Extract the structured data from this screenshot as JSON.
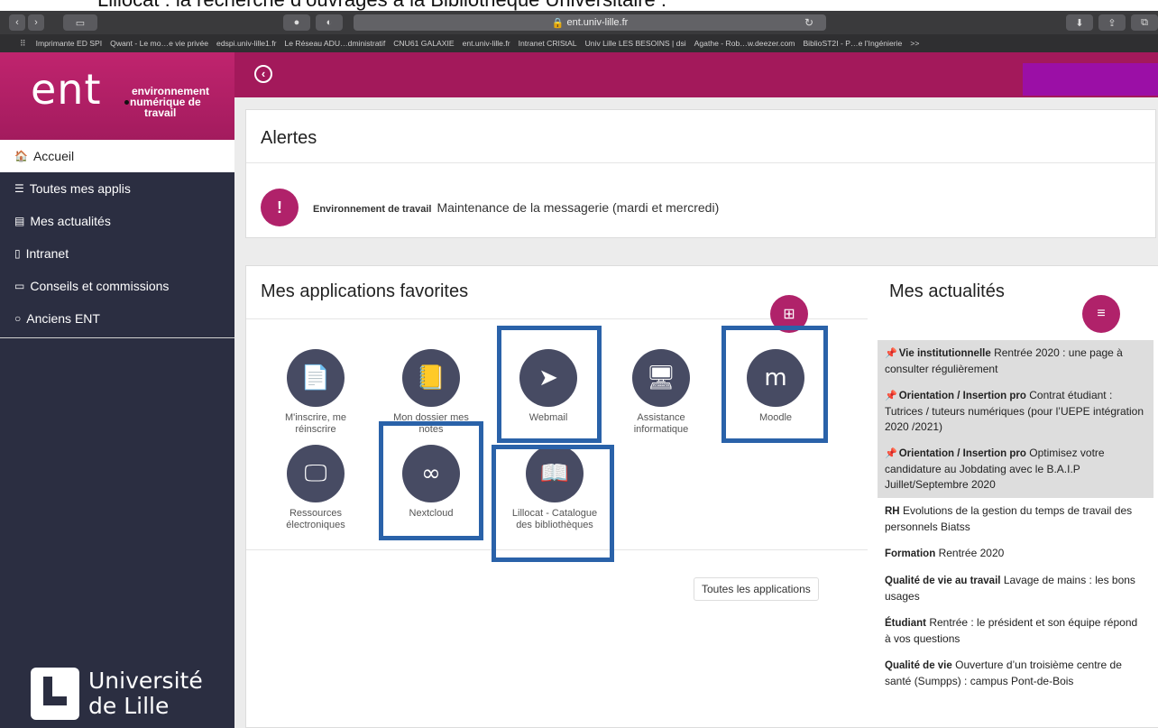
{
  "caption": "Lillocat : la recherche d’ouvrages à la Bibliothèque Universitaire :",
  "browser": {
    "url": "ent.univ-lille.fr",
    "bookmarks": [
      "Imprimante ED SPI",
      "Qwant - Le mo…e vie privée",
      "edspi.univ-lille1.fr",
      "Le Réseau ADU…dministratif",
      "CNU61 GALAXIE",
      "ent.univ-lille.fr",
      "Intranet CRIStAL",
      "Univ Lille LES BESOINS | dsi",
      "Agathe - Rob…w.deezer.com",
      "BiblioST2I - P…e l’Ingénierie",
      ">>"
    ]
  },
  "sidebar": {
    "logo": "ent",
    "tagline": [
      "environnement",
      "numérique de",
      "travail"
    ],
    "items": [
      {
        "label": "Accueil",
        "icon": "home-icon",
        "glyph": "🏠"
      },
      {
        "label": "Toutes mes applis",
        "icon": "list-icon",
        "glyph": "☰"
      },
      {
        "label": "Mes actualités",
        "icon": "newspaper-icon",
        "glyph": "▤"
      },
      {
        "label": "Intranet",
        "icon": "document-icon",
        "glyph": "▯"
      },
      {
        "label": "Conseils et commissions",
        "icon": "folder-icon",
        "glyph": "▭"
      },
      {
        "label": "Anciens ENT",
        "icon": "circle-icon",
        "glyph": "○"
      }
    ],
    "university": [
      "Université",
      "de Lille"
    ]
  },
  "alerts": {
    "title": "Alertes",
    "category": "Environnement de travail",
    "message": "Maintenance de la messagerie (mardi et mercredi)"
  },
  "favorites": {
    "title": "Mes applications favorites",
    "apps": [
      {
        "label": "M'inscrire, me réinscrire",
        "glyph": "📄"
      },
      {
        "label": "Mon dossier mes notes",
        "glyph": "📒"
      },
      {
        "label": "Webmail",
        "glyph": "➤"
      },
      {
        "label": "Assistance informatique",
        "glyph": "🖥"
      },
      {
        "label": "Moodle",
        "glyph": "m"
      },
      {
        "label": "Ressources électroniques",
        "glyph": "🖵"
      },
      {
        "label": "Nextcloud",
        "glyph": "∞"
      },
      {
        "label": "Lillocat - Catalogue des bibliothèques",
        "glyph": "📖"
      }
    ],
    "all_button": "Toutes les applications"
  },
  "news": {
    "title": "Mes actualités",
    "items": [
      {
        "category": "Vie institutionnelle",
        "text": "Rentrée 2020 : une page à consulter régulièrement",
        "pinned": true
      },
      {
        "category": "Orientation / Insertion pro",
        "text": "Contrat étudiant : Tutrices / tuteurs numériques (pour l’UEPE intégration 2020 /2021)",
        "pinned": true
      },
      {
        "category": "Orientation / Insertion pro",
        "text": "Optimisez votre candidature au Jobdating avec le B.A.I.P Juillet/Septembre 2020",
        "pinned": true
      },
      {
        "category": "RH",
        "text": "Evolutions de la gestion du temps de travail des personnels Biatss",
        "pinned": false
      },
      {
        "category": "Formation",
        "text": "Rentrée 2020",
        "pinned": false
      },
      {
        "category": "Qualité de vie au travail",
        "text": "Lavage de mains : les bons usages",
        "pinned": false
      },
      {
        "category": "Étudiant",
        "text": "Rentrée : le président et son équipe répond à vos questions",
        "pinned": false
      },
      {
        "category": "Qualité de vie",
        "text": "Ouverture d’un troisième centre de santé (Sumpps) : campus Pont-de-Bois",
        "pinned": false
      }
    ]
  }
}
